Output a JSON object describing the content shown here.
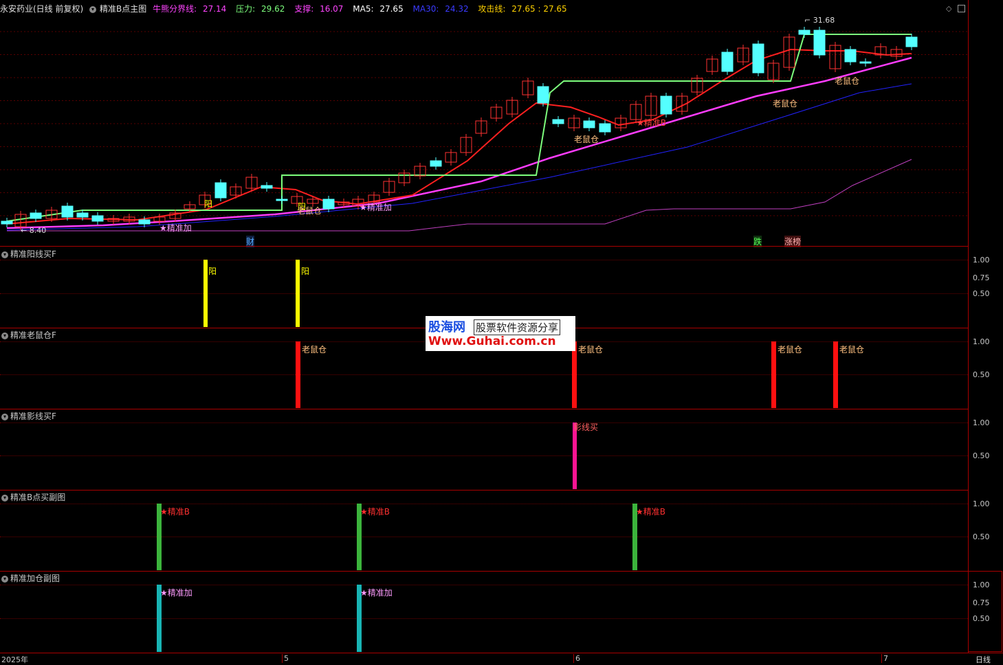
{
  "header": {
    "stock": "永安药业(日线 前复权)",
    "indicator": "精准B点主图",
    "items": [
      {
        "label": "牛熊分界线:",
        "value": "27.14",
        "color": "#ff44ff"
      },
      {
        "label": "压力:",
        "value": "29.62",
        "color": "#7dff7d"
      },
      {
        "label": "支撑:",
        "value": "16.07",
        "color": "#ff44ff"
      },
      {
        "label": "MA5:",
        "value": "27.65",
        "color": "#ffffff"
      },
      {
        "label": "MA30:",
        "value": "24.32",
        "color": "#3b3bff"
      },
      {
        "label": "攻击线:",
        "value": "27.65 : 27.65",
        "color": "#ffd200"
      }
    ]
  },
  "main": {
    "price_ticks": [
      "30.00",
      "27.50",
      "25.00",
      "22.50",
      "20.00",
      "17.50",
      "15.00",
      "12.50",
      "10.00"
    ],
    "high_label": "31.68",
    "low_label": "8.40",
    "annotations": [
      "阳",
      "阳",
      "老鼠仓",
      "★精准加",
      "★精准加",
      "老鼠仓",
      "★精准B",
      "老鼠仓",
      "老鼠仓"
    ],
    "events": {
      "cai": "财",
      "die": "跌",
      "zhangbang": "涨榜"
    }
  },
  "panes": [
    {
      "title": "精准阳线买F",
      "ticks": [
        "1.00",
        "0.75",
        "0.50"
      ],
      "label": "阳"
    },
    {
      "title": "精准老鼠仓F",
      "ticks": [
        "1.00",
        "0.50"
      ],
      "label": "老鼠仓"
    },
    {
      "title": "精准影线买F",
      "ticks": [
        "1.00",
        "0.50"
      ],
      "label": "影线买"
    },
    {
      "title": "精准B点买副图",
      "ticks": [
        "1.00",
        "0.50"
      ],
      "label": "★精准B"
    },
    {
      "title": "精准加仓副图",
      "ticks": [
        "1.00",
        "0.75",
        "0.50"
      ],
      "label": "★精准加"
    }
  ],
  "dates": {
    "year": "2025年",
    "m5": "5",
    "m6": "6",
    "m7": "7"
  },
  "period": "日线",
  "watermark": {
    "line1": "股海网",
    "line2": "股票软件资源分享",
    "url": "Www.Guhai.com.cn"
  },
  "colors": {
    "up": "#ff3232",
    "down": "#54ffff",
    "ma_green": "#7dff7d",
    "ma_red": "#ff2020",
    "ma_magenta": "#ff3cff",
    "ma30_blue": "#2222ff",
    "support": "#c040c0"
  }
}
